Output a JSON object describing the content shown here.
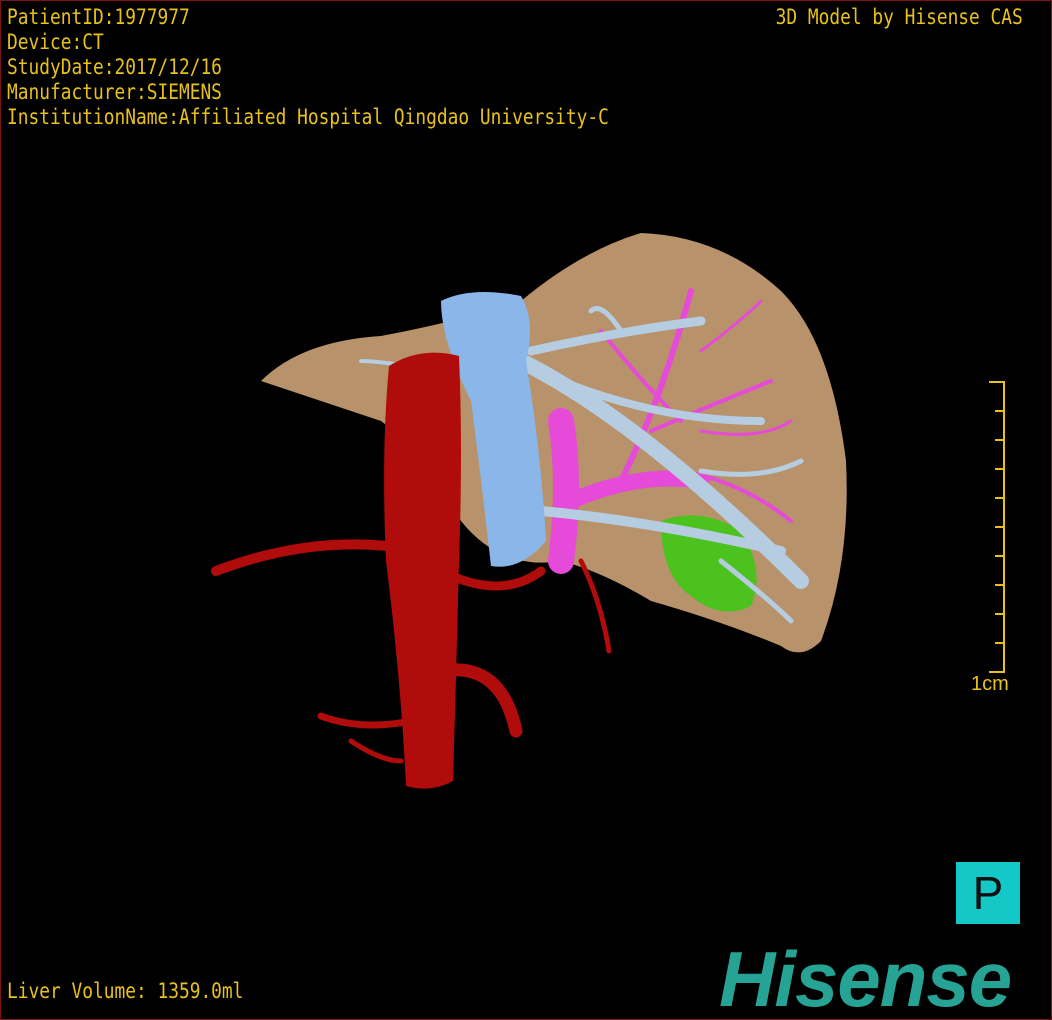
{
  "header": {
    "patient_id": "PatientID:1977977",
    "device": "Device:CT",
    "study_date": "StudyDate:2017/12/16",
    "manufacturer": "Manufacturer:SIEMENS",
    "institution": "InstitutionName:Affiliated Hospital Qingdao University-C",
    "credit": "3D Model by Hisense CAS"
  },
  "footer": {
    "liver_volume": "Liver Volume: 1359.0ml",
    "logo": "Hisense"
  },
  "scale_bar": {
    "label": "1cm",
    "ticks": 10
  },
  "view_button": {
    "label": "P"
  },
  "colors": {
    "text": "#e8c21a",
    "liver": "#b8926a",
    "aorta": "#b00c0c",
    "ivc": "#8ab6ea",
    "portal_vein": "#e64ad8",
    "hepatic_vein": "#b6cce0",
    "lesion": "#4cc21e",
    "logo": "#26a394",
    "button": "#14c8c8"
  }
}
